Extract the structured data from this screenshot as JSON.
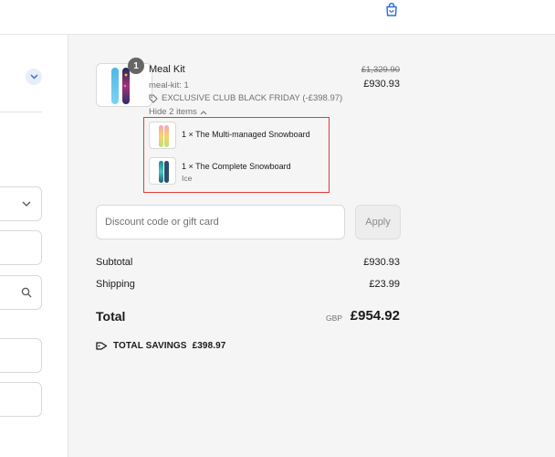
{
  "header": {
    "bag_icon": "shopping-bag-icon",
    "accent": "#2f6fd6"
  },
  "left_panel": {
    "chevron_icon": "chevron-down-icon",
    "search_icon": "search-icon"
  },
  "order": {
    "item": {
      "name": "Meal Kit",
      "variant": "meal-kit: 1",
      "discount": "EXCLUSIVE CLUB BLACK FRIDAY (-£398.97)",
      "toggle": "Hide 2 items",
      "quantity": "1",
      "original_price": "£1,329.90",
      "price": "£930.93"
    },
    "components": [
      {
        "name": "1 × The Multi-managed Snowboard",
        "variant": ""
      },
      {
        "name": "1 × The Complete Snowboard",
        "variant": "Ice"
      }
    ]
  },
  "discount_form": {
    "placeholder": "Discount code or gift card",
    "apply_label": "Apply"
  },
  "summary": {
    "subtotal_label": "Subtotal",
    "subtotal": "£930.93",
    "shipping_label": "Shipping",
    "shipping": "£23.99",
    "total_label": "Total",
    "currency": "GBP",
    "total": "£954.92",
    "savings_label": "TOTAL SAVINGS",
    "savings": "£398.97"
  },
  "colors": {
    "highlight_border": "#e53935",
    "panel_bg": "#f5f5f5"
  }
}
